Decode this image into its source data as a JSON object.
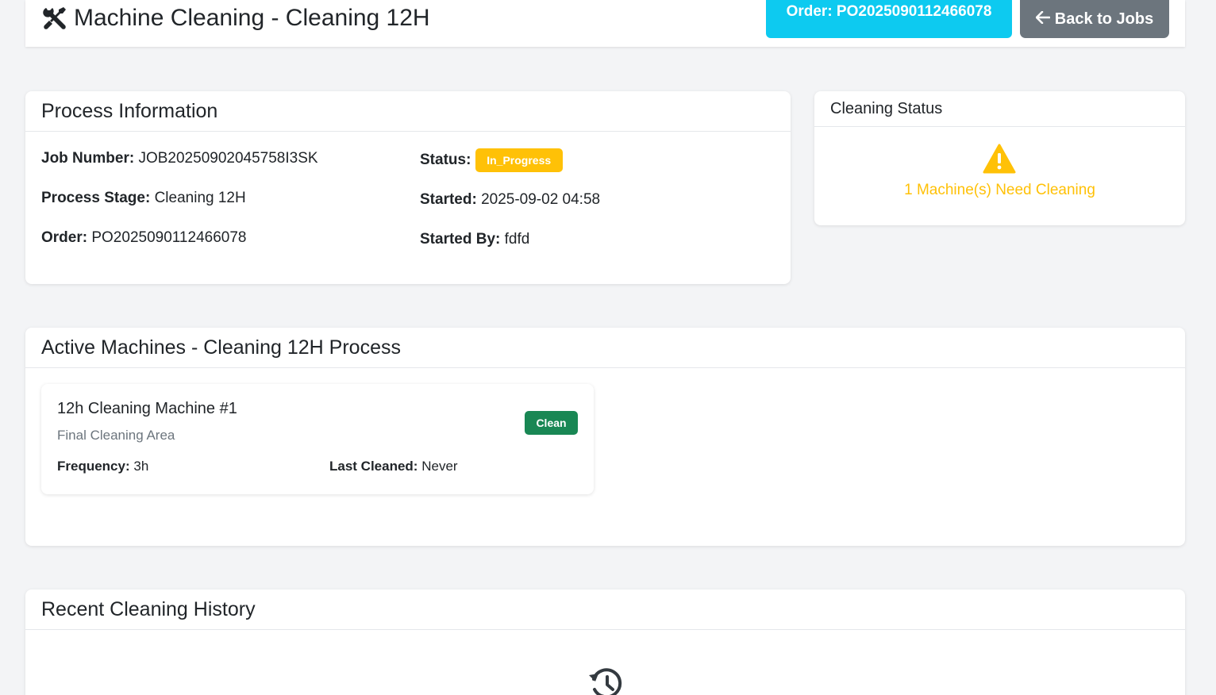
{
  "header": {
    "title": "Machine Cleaning - Cleaning 12H",
    "order_label": "Order: PO2025090112466078",
    "back_label": "Back to Jobs"
  },
  "process_info": {
    "title": "Process Information",
    "job_number_label": "Job Number:",
    "job_number": "JOB20250902045758I3SK",
    "process_stage_label": "Process Stage:",
    "process_stage": "Cleaning 12H",
    "order_label": "Order:",
    "order": "PO2025090112466078",
    "status_label": "Status:",
    "status": "In_Progress",
    "started_label": "Started:",
    "started": "2025-09-02 04:58",
    "started_by_label": "Started By:",
    "started_by": "fdfd"
  },
  "cleaning_status": {
    "title": "Cleaning Status",
    "message": "1 Machine(s) Need Cleaning",
    "icon": "warning-icon"
  },
  "active_machines": {
    "title": "Active Machines - Cleaning 12H Process",
    "machines": [
      {
        "name": "12h Cleaning Machine #1",
        "location": "Final Cleaning Area",
        "status": "Clean",
        "frequency_label": "Frequency:",
        "frequency": "3h",
        "last_cleaned_label": "Last Cleaned:",
        "last_cleaned": "Never"
      }
    ]
  },
  "history": {
    "title": "Recent Cleaning History",
    "icon": "history-icon"
  },
  "colors": {
    "info": "#0dcaf0",
    "secondary": "#6c757d",
    "warning": "#ffc107",
    "success": "#198754"
  }
}
